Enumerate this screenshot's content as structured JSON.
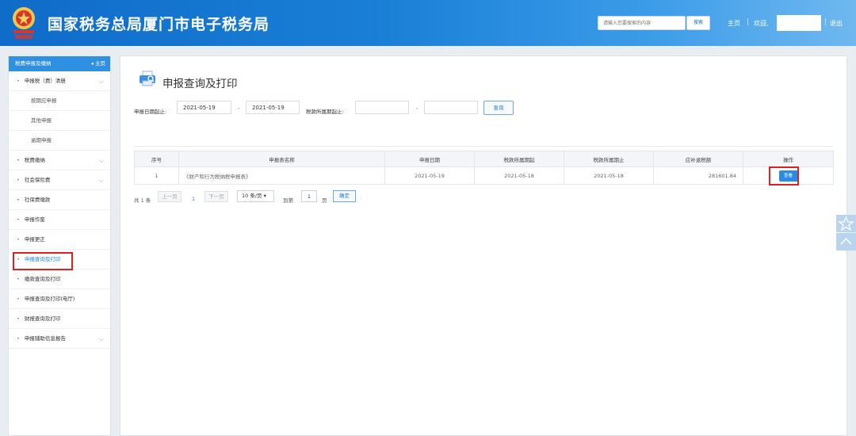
{
  "header": {
    "title": "国家税务总局厦门市电子税务局",
    "emblem_icon": "tax-emblem-icon",
    "search_placeholder": "请输入您要搜索的内容",
    "search_label": "搜索",
    "home_label": "主页",
    "welcome_label": "欢迎,",
    "logout_label": "退出"
  },
  "sidebar": {
    "head_label": "税费申报及缴纳",
    "home_label": "◂ 主页",
    "items": [
      {
        "label": "申报税（费）清册",
        "expandable": true
      },
      {
        "label": "按期应申报",
        "sub": true
      },
      {
        "label": "其他申报",
        "sub": true
      },
      {
        "label": "逾期申报",
        "sub": true
      },
      {
        "label": "税费缴纳",
        "expandable": true
      },
      {
        "label": "社会保险费",
        "expandable": true
      },
      {
        "label": "社保费缴款"
      },
      {
        "label": "申报作废"
      },
      {
        "label": "申报更正"
      },
      {
        "label": "申报查询及打印",
        "active": true
      },
      {
        "label": "缴款查询及打印"
      },
      {
        "label": "申报查询及打印(电厅)"
      },
      {
        "label": "财报查询及打印"
      },
      {
        "label": "申报辅助信息报告",
        "expandable": true
      }
    ]
  },
  "main": {
    "page_title": "申报查询及打印",
    "filters": {
      "decl_date_label": "申报日期起止:",
      "decl_start": "2021-05-19",
      "decl_end": "2021-05-19",
      "period_label": "税款所属期起止:",
      "period_start": "",
      "period_end": "",
      "dash": "-",
      "query_label": "查询"
    },
    "table": {
      "headers": [
        "序号",
        "申报表名称",
        "申报日期",
        "税款所属期起",
        "税款所属期止",
        "应补退税额",
        "操作"
      ],
      "rows": [
        {
          "index": "1",
          "name": "《财产和行为税纳税申报表》",
          "decl_date": "2021-05-19",
          "period_start": "2021-05-18",
          "period_end": "2021-05-18",
          "amount": "281601.84",
          "action": "查看"
        }
      ]
    },
    "pagination": {
      "total": "共 1 条",
      "prev": "上一页",
      "current": "1",
      "next": "下一页",
      "page_size": "10 条/页",
      "goto_prefix": "到第",
      "goto_value": "1",
      "goto_suffix": "页",
      "confirm": "确定"
    }
  },
  "floating": {
    "favorite_icon": "star-icon",
    "top_icon": "chevron-up-icon"
  },
  "colors": {
    "header_blue": "#1a7fd6",
    "accent": "#2b8be4",
    "highlight": "#e02020"
  }
}
